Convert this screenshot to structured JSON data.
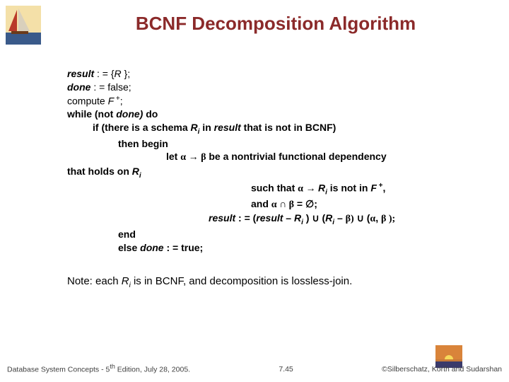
{
  "title": "BCNF Decomposition Algorithm",
  "algo": {
    "l1a": "result",
    "l1b": " : = {",
    "l1c": "R",
    "l1d": " };",
    "l2a": "done",
    "l2b": " : = false;",
    "l3a": "compute ",
    "l3b": "F",
    "l3c": " +",
    "l3d": ";",
    "l4a": "while (not ",
    "l4b": "done)",
    "l4c": " do",
    "l5a": "if ",
    "l5b": "(there is a schema ",
    "l5c": "R",
    "l5d": "i",
    "l5e": " in ",
    "l5f": "result",
    "l5g": "  that is not in BCNF)",
    "l6": "then begin",
    "l7a": "let ",
    "l7b": "α",
    "l7c": "     →  ",
    "l7d": "β",
    "l7e": "  be a nontrivial functional dependency",
    "l8a": "that holds on ",
    "l8b": "R",
    "l8c": "i",
    "l9a": "such that ",
    "l9b": "α",
    "l9c": "    → ",
    "l9d": "R",
    "l9e": "i",
    "l9f": " is not in ",
    "l9g": "F",
    "l9h": " +",
    "l9i": ",",
    "l10a": "and ",
    "l10b": "α ∩ β",
    "l10c": "   = ",
    "l10d": "∅",
    "l10e": ";",
    "l11a": "result",
    "l11b": " : = (",
    "l11c": "result",
    "l11d": " – ",
    "l11e": "R",
    "l11f": "i",
    "l11g": " ) ∪ (",
    "l11h": "R",
    "l11i": "i",
    "l11j": " – ",
    "l11k": "β)",
    "l11l": " ∪ (",
    "l11m": "α",
    "l11n": ", ",
    "l11o": "β );",
    "l12": "end",
    "l13a": "else ",
    "l13b": "done",
    "l13c": " : = true;"
  },
  "note": {
    "a": "Note:  each ",
    "b": "R",
    "c": "i",
    "d": " is in BCNF, and decomposition is lossless-join."
  },
  "footer": {
    "left_a": "Database System Concepts - 5",
    "left_b": "th",
    "left_c": " Edition, July 28,  2005.",
    "center": "7.45",
    "right": "©Silberschatz, Korth and Sudarshan"
  }
}
